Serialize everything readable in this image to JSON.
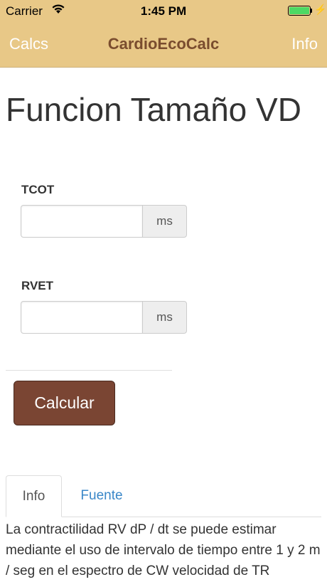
{
  "status_bar": {
    "carrier": "Carrier",
    "time": "1:45 PM",
    "battery_color": "#4cd964"
  },
  "nav": {
    "left": "Calcs",
    "title": "CardioEcoCalc",
    "right": "Info",
    "bar_color": "#e8c887",
    "title_color": "#7a4d2e"
  },
  "page": {
    "title": "Funcion Tamaño VD"
  },
  "fields": [
    {
      "label": "TCOT",
      "value": "",
      "unit": "ms"
    },
    {
      "label": "RVET",
      "value": "",
      "unit": "ms"
    }
  ],
  "calculate_button": {
    "label": "Calcular",
    "color": "#7a4533"
  },
  "tabs": [
    {
      "label": "Info",
      "active": true
    },
    {
      "label": "Fuente",
      "active": false
    }
  ],
  "info_text": "La contractilidad RV dP / dt se puede estimar mediante el uso de intervalo de tiempo entre 1 y 2 m / seg en el espectro de CW velocidad de TR"
}
